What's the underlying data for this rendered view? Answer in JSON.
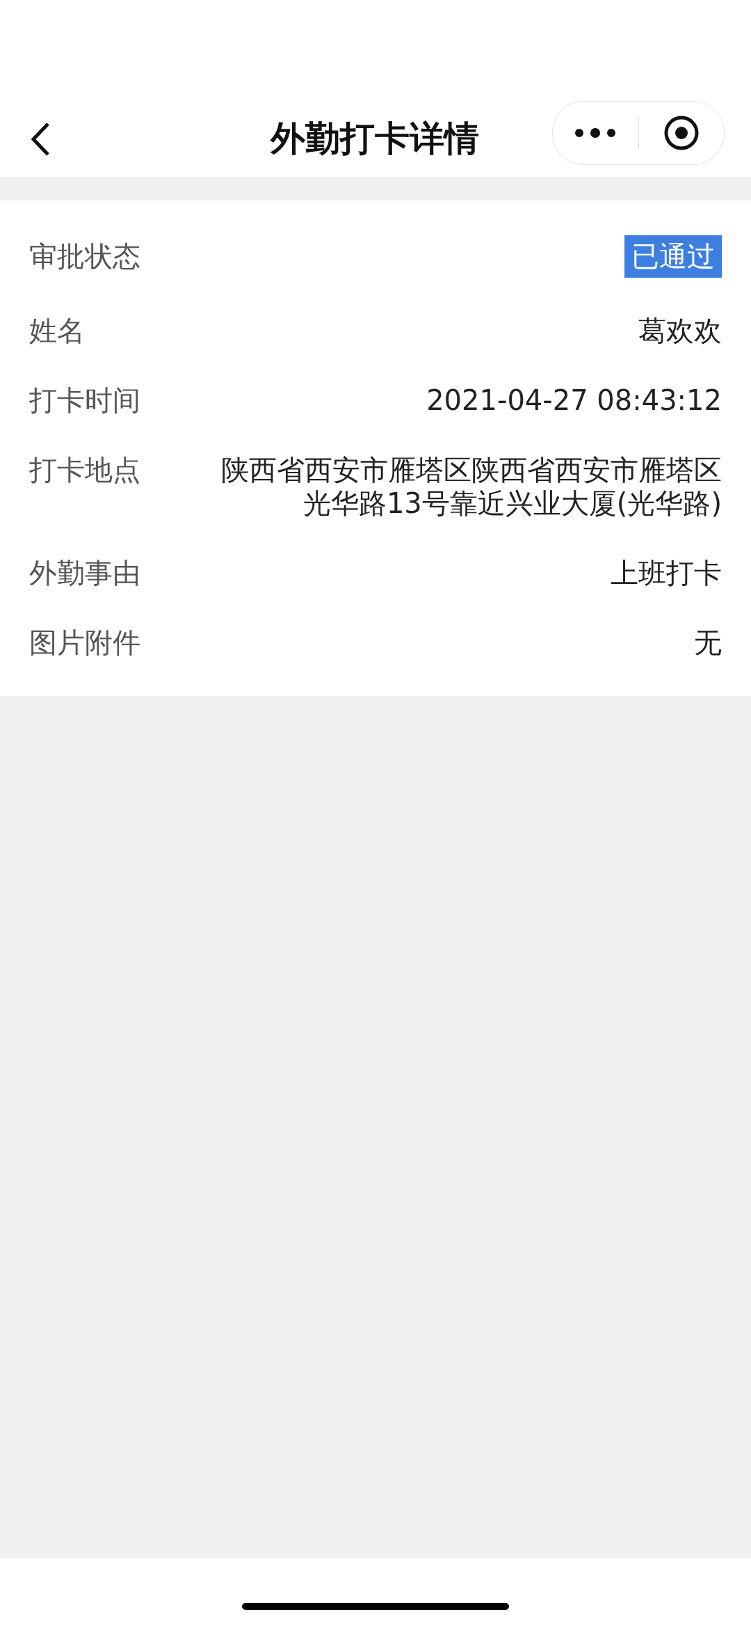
{
  "nav": {
    "title": "外勤打卡详情"
  },
  "rows": [
    {
      "kind": "badge",
      "label": "审批状态",
      "value": "已通过"
    },
    {
      "kind": "text",
      "label": "姓名",
      "value": "葛欢欢"
    },
    {
      "kind": "text",
      "label": "打卡时间",
      "value": "2021-04-27 08:43:12"
    },
    {
      "kind": "text",
      "label": "打卡地点",
      "value": "陕西省西安市雁塔区陕西省西安市雁塔区光华路13号靠近兴业大厦(光华路)"
    },
    {
      "kind": "text",
      "label": "外勤事由",
      "value": "上班打卡"
    },
    {
      "kind": "text",
      "label": "图片附件",
      "value": "无"
    }
  ]
}
